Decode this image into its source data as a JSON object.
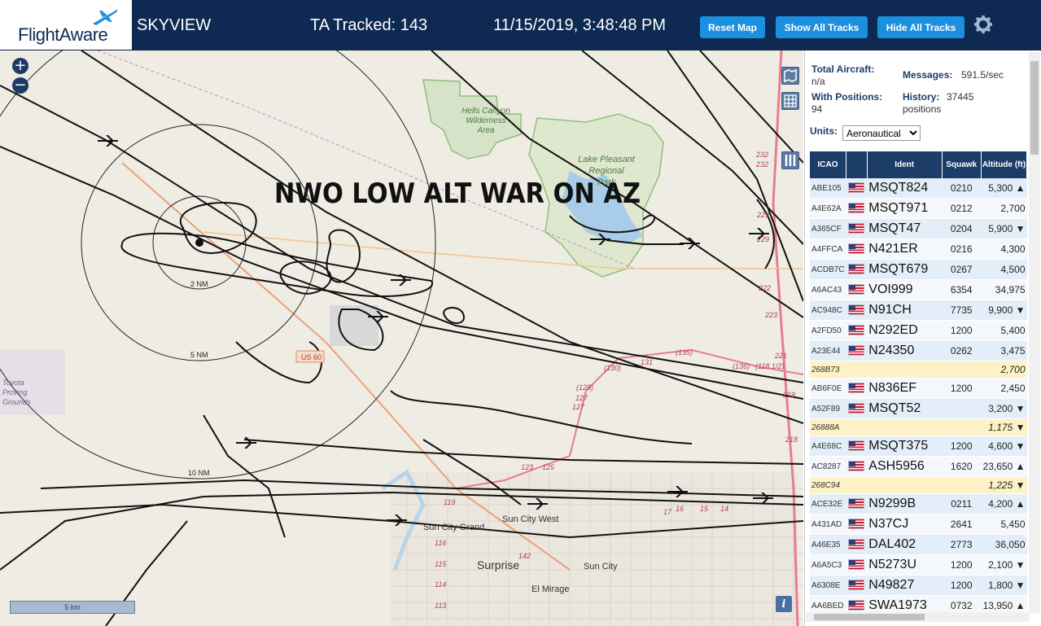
{
  "header": {
    "logo_text": "FlightAware",
    "app_name": "SKYVIEW",
    "tracked_label": "TA Tracked: 143",
    "datetime": "11/15/2019, 3:48:48 PM",
    "buttons": {
      "reset_map": "Reset Map",
      "show_all_tracks": "Show All Tracks",
      "hide_all_tracks": "Hide All Tracks"
    },
    "colors": {
      "bar": "#0e2a52",
      "button": "#1b8fe0"
    }
  },
  "map": {
    "overlay_text": "NWO LOW ALT WAR ON AZ",
    "zoom_in": "+",
    "zoom_out": "−",
    "scale_label": "5 km",
    "info_label": "i",
    "labels": {
      "hells_canyon": [
        "Hells Canyon",
        "Wilderness",
        "Area"
      ],
      "lake_pleasant": [
        "Lake Pleasant",
        "Regional",
        "Park"
      ],
      "ring_2nm": "2 NM",
      "ring_5nm": "5 NM",
      "ring_10nm": "10 NM",
      "us60": "US 60",
      "toyota": [
        "Toyota",
        "Proving",
        "Grounds"
      ],
      "sun_city_grand": "Sun City Grand",
      "sun_city_west": "Sun City West",
      "surprise": "Surprise",
      "sun_city": "Sun City",
      "el_mirage": "El Mirage",
      "roads": [
        "232",
        "232",
        "229",
        "229",
        "223",
        "222",
        "221",
        "219",
        "218",
        "131",
        "(135)",
        "(130)",
        "(128)",
        "127",
        "127",
        "(136)",
        "(118 1/2)",
        "123",
        "125",
        "119",
        "116",
        "115",
        "114",
        "113",
        "142",
        "17",
        "16",
        "15",
        "14"
      ]
    }
  },
  "panel": {
    "total_aircraft_label": "Total Aircraft:",
    "total_aircraft_value": "n/a",
    "with_positions_label": "With Positions:",
    "with_positions_value": "94",
    "messages_label": "Messages:",
    "messages_value": "591.5/sec",
    "history_label": "History:",
    "history_value": "37445",
    "history_unit": "positions",
    "units_label": "Units:",
    "units_value": "Aeronautical",
    "columns": [
      "ICAO",
      "",
      "Ident",
      "Squawk",
      "Altitude (ft)"
    ],
    "rows": [
      {
        "icao": "ABE105",
        "ident": "MSQT824",
        "squawk": "0210",
        "alt": "5,300 ▲",
        "type": "blue"
      },
      {
        "icao": "A4E62A",
        "ident": "MSQT971",
        "squawk": "0212",
        "alt": "2,700",
        "type": "white"
      },
      {
        "icao": "A365CF",
        "ident": "MSQT47",
        "squawk": "0204",
        "alt": "5,900 ▼",
        "type": "blue"
      },
      {
        "icao": "A4FFCA",
        "ident": "N421ER",
        "squawk": "0216",
        "alt": "4,300",
        "type": "white"
      },
      {
        "icao": "ACDB7C",
        "ident": "MSQT679",
        "squawk": "0267",
        "alt": "4,500",
        "type": "blue"
      },
      {
        "icao": "A6AC43",
        "ident": "VOI999",
        "squawk": "6354",
        "alt": "34,975",
        "type": "white"
      },
      {
        "icao": "AC948C",
        "ident": "N91CH",
        "squawk": "7735",
        "alt": "9,900 ▼",
        "type": "blue"
      },
      {
        "icao": "A2FD50",
        "ident": "N292ED",
        "squawk": "1200",
        "alt": "5,400",
        "type": "white"
      },
      {
        "icao": "A23E44",
        "ident": "N24350",
        "squawk": "0262",
        "alt": "3,475",
        "type": "blue"
      },
      {
        "icao": "268B73",
        "ident": "",
        "squawk": "",
        "alt": "2,700",
        "type": "yellow"
      },
      {
        "icao": "AB6F0E",
        "ident": "N836EF",
        "squawk": "1200",
        "alt": "2,450",
        "type": "white"
      },
      {
        "icao": "A52F89",
        "ident": "MSQT52",
        "squawk": "",
        "alt": "3,200 ▼",
        "type": "blue"
      },
      {
        "icao": "26888A",
        "ident": "",
        "squawk": "",
        "alt": "1,175 ▼",
        "type": "yellow"
      },
      {
        "icao": "A4E68C",
        "ident": "MSQT375",
        "squawk": "1200",
        "alt": "4,600 ▼",
        "type": "blue"
      },
      {
        "icao": "AC8287",
        "ident": "ASH5956",
        "squawk": "1620",
        "alt": "23,650 ▲",
        "type": "white"
      },
      {
        "icao": "268C94",
        "ident": "",
        "squawk": "",
        "alt": "1,225 ▼",
        "type": "yellow"
      },
      {
        "icao": "ACE32E",
        "ident": "N9299B",
        "squawk": "0211",
        "alt": "4,200 ▲",
        "type": "blue"
      },
      {
        "icao": "A431AD",
        "ident": "N37CJ",
        "squawk": "2641",
        "alt": "5,450",
        "type": "white"
      },
      {
        "icao": "A46E35",
        "ident": "DAL402",
        "squawk": "2773",
        "alt": "36,050",
        "type": "blue"
      },
      {
        "icao": "A6A5C3",
        "ident": "N5273U",
        "squawk": "1200",
        "alt": "2,100 ▼",
        "type": "white"
      },
      {
        "icao": "A6308E",
        "ident": "N49827",
        "squawk": "1200",
        "alt": "1,800 ▼",
        "type": "blue"
      },
      {
        "icao": "AA6BED",
        "ident": "SWA1973",
        "squawk": "0732",
        "alt": "13,950 ▲",
        "type": "white"
      }
    ]
  }
}
